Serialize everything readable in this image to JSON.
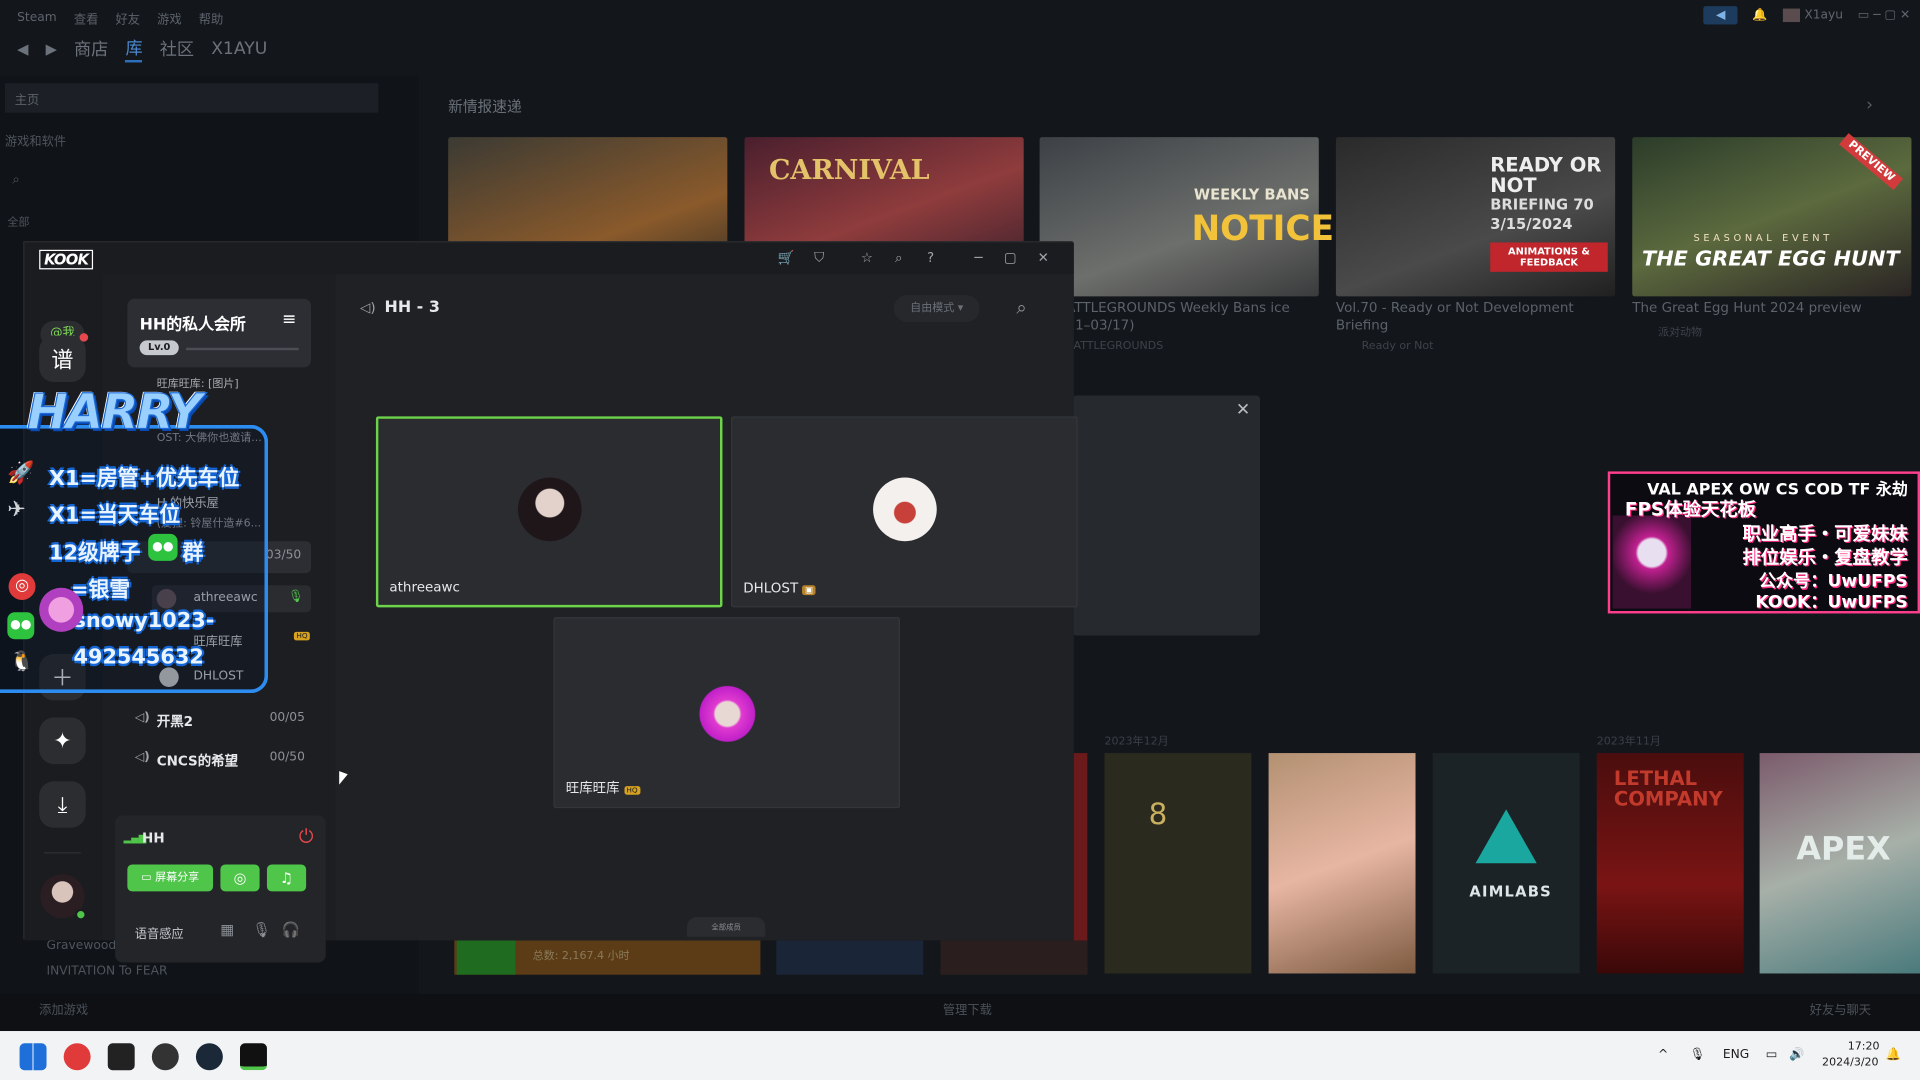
{
  "steam": {
    "menu": [
      "Steam",
      "查看",
      "好友",
      "游戏",
      "帮助"
    ],
    "nav": [
      "商店",
      "库",
      "社区",
      "X1AYU"
    ],
    "account": "X1ayu",
    "home": "主页",
    "filter": "游戏和软件",
    "all_label": "全部",
    "news_title": "新情报速递",
    "news": [
      {
        "caption": "",
        "sub": ""
      },
      {
        "caption": "",
        "sub": ""
      },
      {
        "caption": "S: BATTLEGROUNDS Weekly Bans ice (03/11–03/17)",
        "sub": "JBG: BATTLEGROUNDS"
      },
      {
        "caption": "Vol.70 - Ready or Not Development Briefing",
        "sub": "Ready or Not"
      },
      {
        "caption": "The Great Egg Hunt 2024 preview",
        "sub": "派对动物"
      }
    ],
    "tile_text": {
      "carnival": "CARNIVAL",
      "weekly": "WEEKLY BANS",
      "notice": "NOTICE",
      "ready": "READY OR NOT",
      "briefing": "BRIEFING 70",
      "date": "3/15/2024",
      "anim": "ANIMATIONS & FEEDBACK",
      "seasonal": "SEASONAL EVENT",
      "egg": "THE GREAT EGG HUNT",
      "preview": "PREVIEW",
      "aimlabs": "AIMLABS",
      "lethal": "LETHAL COMPANY",
      "apex": "APEX",
      "eight": "8"
    },
    "months": [
      "2023年12月",
      "2023年11月"
    ],
    "games": [
      "Gravewood High",
      "INVITATION To FEAR"
    ],
    "add_game": "添加游戏",
    "manage_downloads": "管理下载",
    "friends_chat": "好友与聊天",
    "playtime": "总数: 2,167.4 小时"
  },
  "kook": {
    "logo": "KOOK",
    "me": "@我",
    "rail_pu": "谱",
    "guild": {
      "name": "HH的私人会所",
      "level": "Lv.0",
      "menu": "≡"
    },
    "messages": [
      {
        "text": "旺库旺库: [图片]"
      },
      {
        "text": "OST: 大佛你也邀请..."
      },
      {
        "text": "H 的快乐屋"
      },
      {
        "text": "(爱捏: 铃屋什造#6..."
      }
    ],
    "active_channel": {
      "count": "03/50"
    },
    "members": [
      "athreeawc",
      "旺库旺库",
      "DHLOST"
    ],
    "channels": [
      {
        "name": "开黑2",
        "count": "00/05"
      },
      {
        "name": "CNCS的希望",
        "count": "00/50"
      }
    ],
    "voice": {
      "name": "HH",
      "share": "屏幕分享",
      "detect": "语音感应"
    },
    "main": {
      "title": "HH - 3",
      "mode": "自由模式",
      "collapse": "全部成员",
      "tiles": [
        {
          "name": "athreeawc",
          "speaking": true
        },
        {
          "name": "DHLOST",
          "speaking": false
        },
        {
          "name": "旺库旺库",
          "speaking": false
        }
      ],
      "badge": "HQ"
    }
  },
  "overlay": {
    "title": "HARRY",
    "lines": [
      "X1=房管+优先车位",
      "X1=当天车位",
      "12级牌子",
      "群",
      "=银雪",
      "snowy1023-",
      "492545632"
    ]
  },
  "promo": {
    "lines": [
      "VAL APEX OW CS COD TF 永劫",
      "FPS体验天花板",
      "职业高手・可爱妹妹",
      "排位娱乐・复盘教学",
      "公众号：UwUFPS",
      "KOOK：UwUFPS"
    ]
  },
  "taskbar": {
    "lang": "ENG",
    "time": "17:20",
    "date": "2024/3/20"
  },
  "colors": {
    "kook_green": "#4fc54a",
    "accent_blue": "#2d8cf0",
    "danger": "#e5484d"
  }
}
